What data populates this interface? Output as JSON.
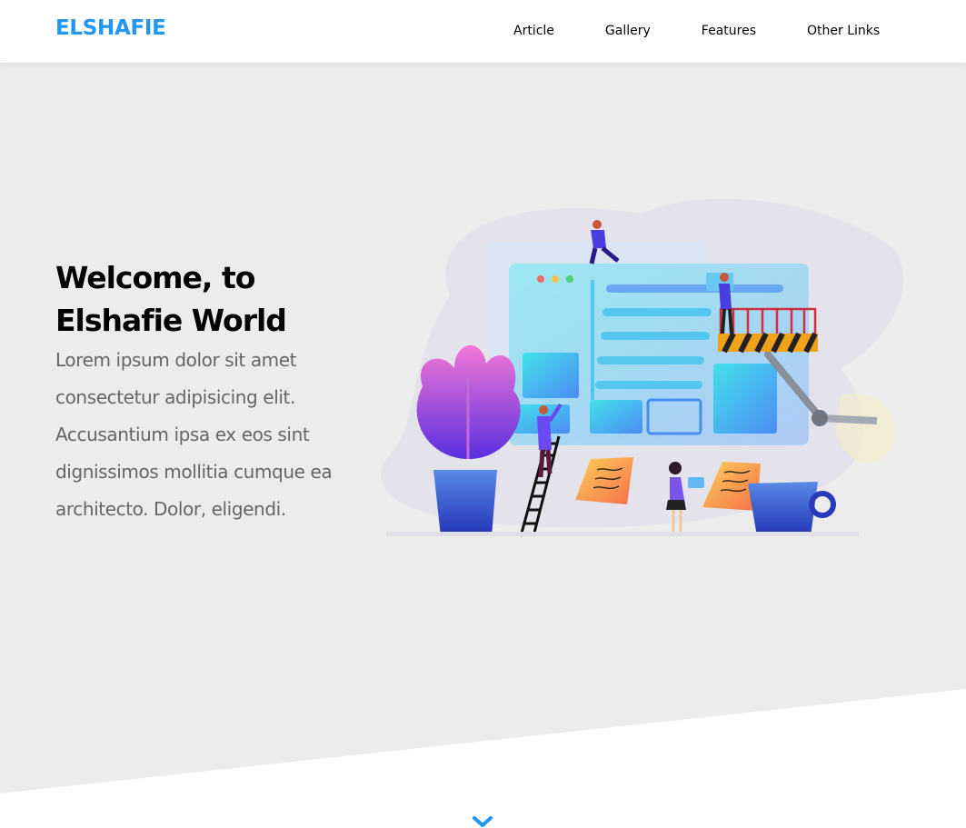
{
  "header": {
    "logo": "ELSHAFIE",
    "nav": [
      {
        "label": "Article"
      },
      {
        "label": "Gallery"
      },
      {
        "label": "Features"
      },
      {
        "label": "Other Links"
      }
    ]
  },
  "hero": {
    "title_line1": "Welcome, to",
    "title_line2": "Elshafie World",
    "description": "Lorem ipsum dolor sit amet consectetur adipisicing elit. Accusantium ipsa ex eos sint dignissimos mollitia cumque ea architecto. Dolor, eligendi."
  },
  "icons": {
    "scroll_down": "chevron-down-icon"
  },
  "colors": {
    "brand": "#2196f3",
    "hero_background": "#ececec",
    "header_background": "#ffffff",
    "title_text": "#000000",
    "body_text": "#666666"
  }
}
